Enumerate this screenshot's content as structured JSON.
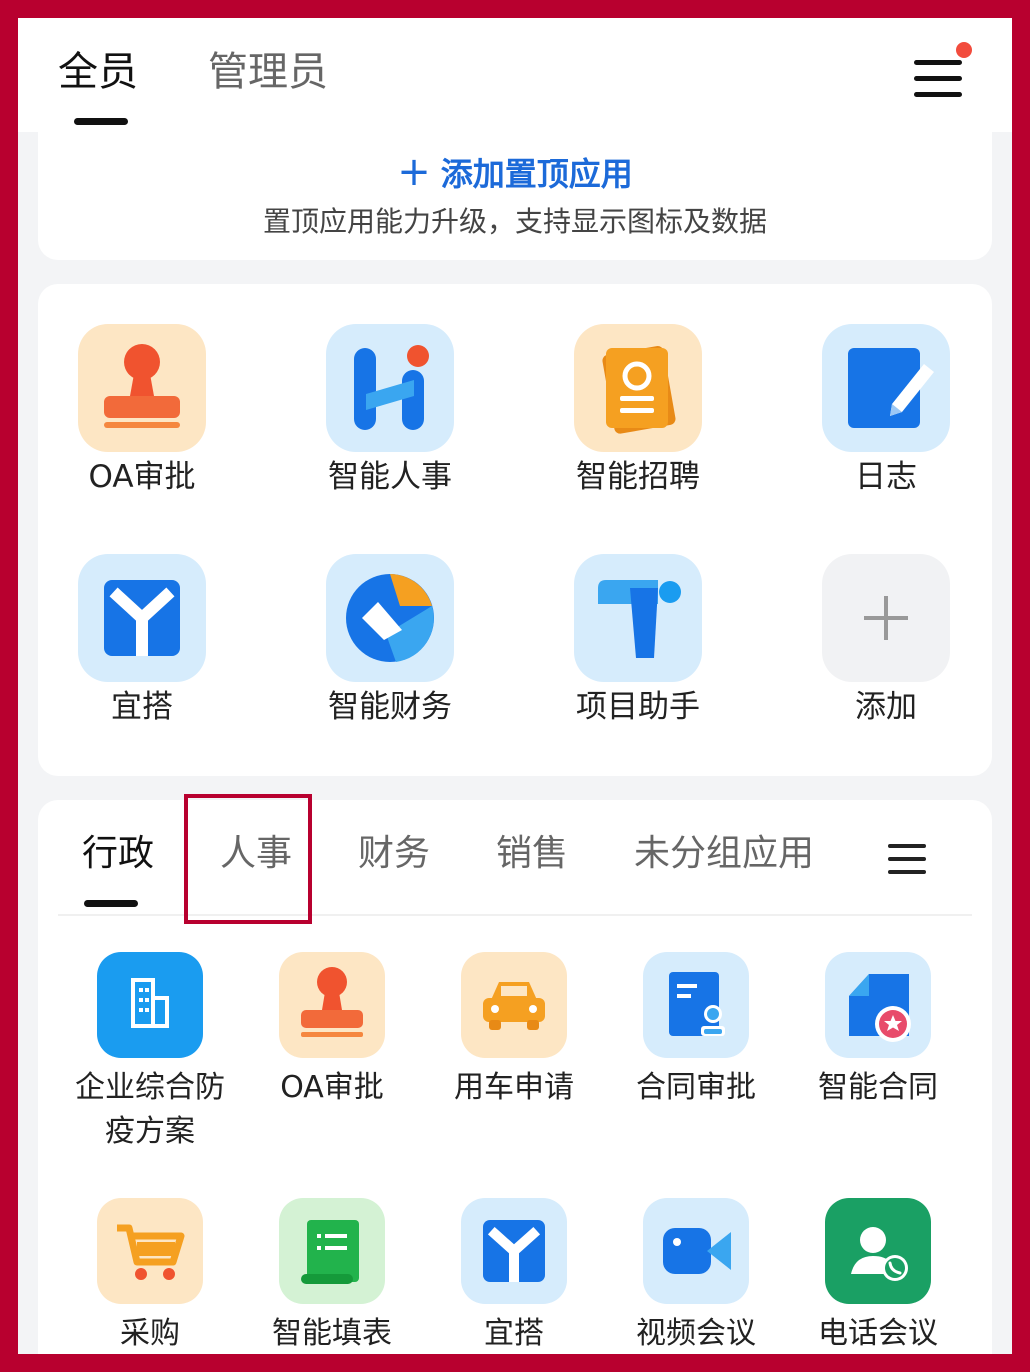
{
  "header": {
    "tabs": [
      {
        "label": "全员",
        "active": true
      },
      {
        "label": "管理员",
        "active": false
      }
    ],
    "menu_icon": "hamburger-menu-icon",
    "has_notification_dot": true
  },
  "pinned": {
    "add_label": "添加置顶应用",
    "subtitle": "置顶应用能力升级，支持显示图标及数据"
  },
  "apps": [
    {
      "label": "OA审批",
      "icon": "stamp-icon"
    },
    {
      "label": "智能人事",
      "icon": "hr-h-icon"
    },
    {
      "label": "智能招聘",
      "icon": "recruit-card-icon"
    },
    {
      "label": "日志",
      "icon": "notebook-pen-icon"
    },
    {
      "label": "宜搭",
      "icon": "yida-icon"
    },
    {
      "label": "智能财务",
      "icon": "finance-icon"
    },
    {
      "label": "项目助手",
      "icon": "project-t-icon"
    },
    {
      "label": "添加",
      "icon": "plus-icon"
    }
  ],
  "categories": {
    "tabs": [
      {
        "label": "行政",
        "active": true
      },
      {
        "label": "人事",
        "active": false
      },
      {
        "label": "财务",
        "active": false
      },
      {
        "label": "销售",
        "active": false
      },
      {
        "label": "未分组应用",
        "active": false
      }
    ],
    "menu_icon": "list-menu-icon",
    "apps": [
      {
        "label": "企业综合防疫方案",
        "label_line1": "企业综合防",
        "label_line2": "疫方案",
        "icon": "building-icon"
      },
      {
        "label": "OA审批",
        "icon": "stamp-icon"
      },
      {
        "label": "用车申请",
        "icon": "car-icon"
      },
      {
        "label": "合同审批",
        "icon": "contract-approve-icon"
      },
      {
        "label": "智能合同",
        "icon": "smart-contract-icon"
      },
      {
        "label": "采购",
        "icon": "cart-icon"
      },
      {
        "label": "智能填表",
        "icon": "form-scroll-icon"
      },
      {
        "label": "宜搭",
        "icon": "yida-icon"
      },
      {
        "label": "视频会议",
        "icon": "video-camera-icon"
      },
      {
        "label": "电话会议",
        "icon": "phone-contact-icon"
      }
    ]
  },
  "colors": {
    "frame": "#b8002f",
    "accent_blue": "#1c6ad9",
    "notification_red": "#f24c3d"
  }
}
